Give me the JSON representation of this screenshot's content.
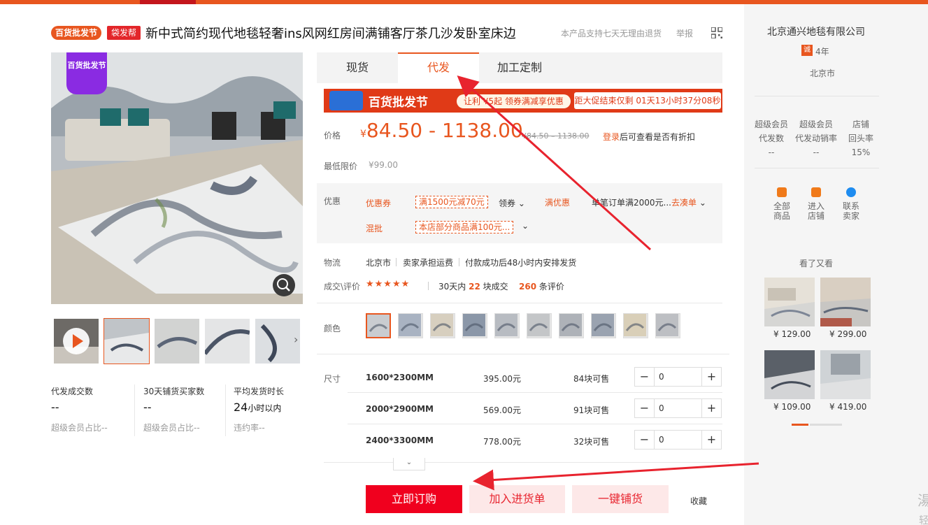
{
  "header": {
    "badge_fest": "百货批发节",
    "badge_bag": "袋发帮",
    "title": "新中式简约现代地毯轻奢ins风网红房间满铺客厅茶几沙发卧室床边",
    "policy": "本产品支持七天无理由退货",
    "report": "举报"
  },
  "gallery": {
    "fest_logo": "百货批发节",
    "thumbs_count": 5,
    "stats": [
      {
        "label": "代发成交数",
        "value": "--",
        "sub": "超级会员占比--"
      },
      {
        "label": "30天铺货买家数",
        "value": "--",
        "sub": "超级会员占比--"
      },
      {
        "label": "平均发货时长",
        "value_num": "24",
        "value_unit": "小时以内",
        "sub": "违约率--"
      }
    ]
  },
  "tabs": [
    {
      "label": "现货",
      "active": false
    },
    {
      "label": "代发",
      "active": true
    },
    {
      "label": "加工定制",
      "active": false
    }
  ],
  "banner": {
    "title": "百货批发节",
    "deal": "让利 ¥5起 领券满减享优惠",
    "countdown": "距大促结束仅剩 01天13小时37分08秒"
  },
  "price": {
    "label": "价格",
    "currency": "¥",
    "range": "84.50 - 1138.00",
    "original": "¥84.50 – 1138.00",
    "login_link": "登录",
    "login_rest": "后可查看是否有折扣",
    "min_label": "最低限价",
    "min_value": "¥99.00"
  },
  "promotions": {
    "label": "优惠",
    "coupon_label": "优惠券",
    "coupon_value": "满1500元减70元",
    "coupon_action": "领券",
    "full_label": "满优惠",
    "full_value": "单笔订单满2000元...",
    "full_action": "去凑单",
    "mix_label": "混批",
    "mix_value": "本店部分商品满100元..."
  },
  "logistics": {
    "label": "物流",
    "city": "北京市",
    "fee": "卖家承担运费",
    "ship": "付款成功后48小时内安排发货"
  },
  "reviews": {
    "label": "成交\\评价",
    "stars": "★★★★★",
    "sold_prefix": "30天内",
    "sold_count": "22",
    "sold_suffix": "块成交",
    "review_count": "260",
    "review_suffix": "条评价"
  },
  "color": {
    "label": "颜色",
    "options_count": 10
  },
  "sizes": {
    "label": "尺寸",
    "rows": [
      {
        "name": "1600*2300MM",
        "price": "395.00元",
        "stock": "84块可售",
        "qty": "0"
      },
      {
        "name": "2000*2900MM",
        "price": "569.00元",
        "stock": "91块可售",
        "qty": "0"
      },
      {
        "name": "2400*3300MM",
        "price": "778.00元",
        "stock": "32块可售",
        "qty": "0"
      }
    ]
  },
  "actions": {
    "buy": "立即订购",
    "cart": "加入进货单",
    "distribute": "一键铺货",
    "favorite": "收藏"
  },
  "store": {
    "name": "北京通兴地毯有限公司",
    "badge": "诚",
    "years": "4年",
    "city": "北京市",
    "stats": [
      {
        "l1": "超级会员",
        "l2": "代发数",
        "v": "--"
      },
      {
        "l1": "超级会员",
        "l2": "代发动销率",
        "v": "--"
      },
      {
        "l1": "店铺",
        "l2": "回头率",
        "v": "15%"
      }
    ],
    "links": [
      {
        "l1": "全部",
        "l2": "商品",
        "color": "#f07a1a"
      },
      {
        "l1": "进入",
        "l2": "店铺",
        "color": "#f07a1a"
      },
      {
        "l1": "联系",
        "l2": "卖家",
        "color": "#1e8cf0"
      }
    ],
    "also_viewed": "看了又看",
    "recommend": [
      {
        "price": "¥ 129.00"
      },
      {
        "price": "¥ 299.00"
      },
      {
        "price": "¥ 109.00"
      },
      {
        "price": "¥ 419.00"
      }
    ],
    "edge1": "湯",
    "edge2": "轻"
  },
  "colors": {
    "accent": "#e8561f",
    "buy": "#f0001e",
    "secondary_bg": "#fde8e8"
  }
}
